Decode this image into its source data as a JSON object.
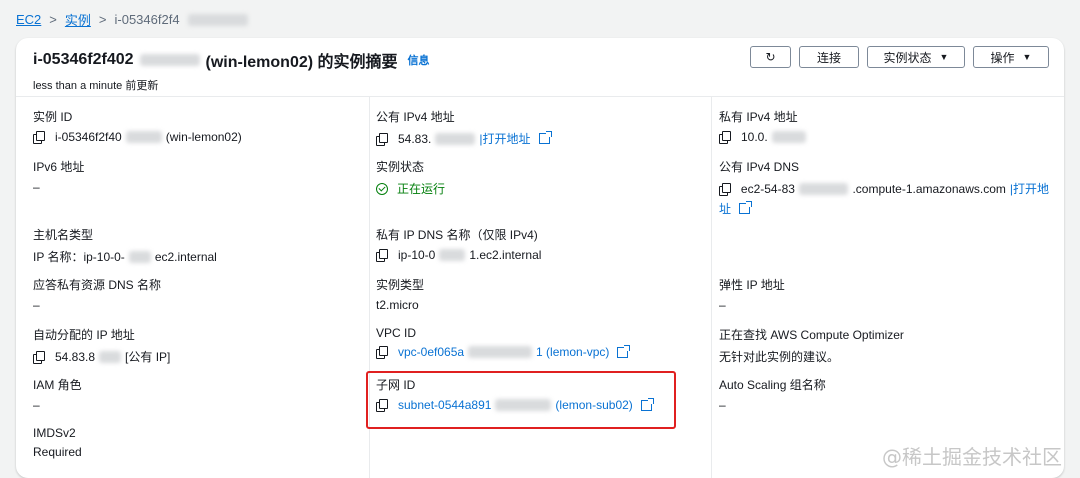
{
  "breadcrumb": {
    "root": "EC2",
    "section": "实例",
    "current": "i-05346f2f4"
  },
  "header": {
    "title_prefix": "i-05346f2f402",
    "title_suffix": "(win-lemon02) 的实例摘要",
    "info": "信息",
    "updated": "less than a minute 前更新"
  },
  "buttons": {
    "refresh": "↻",
    "connect": "连接",
    "state": "实例状态",
    "actions": "操作"
  },
  "col1": {
    "instance_id": {
      "label": "实例 ID",
      "value_a": "i-05346f2f40",
      "value_b": "(win-lemon02)"
    },
    "ipv6": {
      "label": "IPv6 地址",
      "value": "–"
    },
    "hostname_type": {
      "label": "主机名类型",
      "value_a": "IP 名称：ip-10-0-",
      "value_b": "ec2.internal"
    },
    "resp_dns": {
      "label": "应答私有资源 DNS 名称",
      "value": "–"
    },
    "auto_ip": {
      "label": "自动分配的 IP 地址",
      "value_a": "54.83.8",
      "value_b": "[公有 IP]"
    },
    "iam": {
      "label": "IAM 角色",
      "value": "–"
    },
    "imds": {
      "label": "IMDSv2",
      "value": "Required"
    }
  },
  "col2": {
    "public_ipv4": {
      "label": "公有 IPv4 地址",
      "value_a": "54.83.",
      "link": "|打开地址"
    },
    "state": {
      "label": "实例状态",
      "value": "正在运行"
    },
    "private_dns": {
      "label": "私有 IP DNS 名称（仅限 IPv4)",
      "value_a": "ip-10-0",
      "value_b": "1.ec2.internal"
    },
    "type": {
      "label": "实例类型",
      "value": "t2.micro"
    },
    "vpc": {
      "label": "VPC ID",
      "value_a": "vpc-0ef065a",
      "value_b": "1 (lemon-vpc)"
    },
    "subnet": {
      "label": "子网 ID",
      "value_a": "subnet-0544a891",
      "value_b": "(lemon-sub02)"
    }
  },
  "col3": {
    "private_ipv4": {
      "label": "私有 IPv4 地址",
      "value_a": "10.0."
    },
    "public_dns": {
      "label": "公有 IPv4 DNS",
      "value_a": "ec2-54-83",
      "value_b": ".compute-1.amazonaws.com",
      "link1": "|打开地",
      "link2": "址"
    },
    "eip": {
      "label": "弹性 IP 地址",
      "value": "–"
    },
    "optimizer": {
      "label": "正在查找 AWS Compute Optimizer",
      "value": "无针对此实例的建议。"
    },
    "asg": {
      "label": "Auto Scaling 组名称",
      "value": "–"
    }
  },
  "watermark": "@稀土掘金技术社区"
}
